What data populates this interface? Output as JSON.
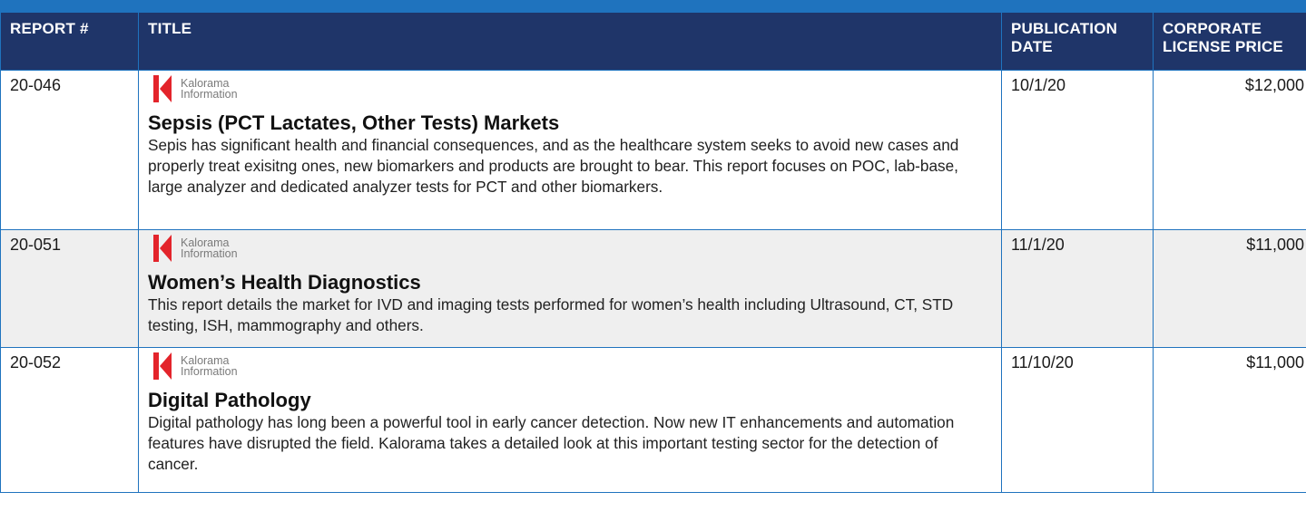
{
  "table": {
    "headers": {
      "report_num": "REPORT #",
      "title": "TITLE",
      "pub_date": "PUBLICATION DATE",
      "price": "CORPORATE LICENSE PRICE"
    },
    "rows": [
      {
        "report_num": "20-046",
        "publisher_line1": "Kalorama",
        "publisher_line2": "Information",
        "title": "Sepsis (PCT Lactates, Other Tests) Markets",
        "description": "Sepis has significant health and financial consequences, and as the healthcare system seeks to avoid new cases and properly treat exisitng ones, new biomarkers and products are brought to bear. This report focuses on POC, lab-base, large analyzer and dedicated analyzer tests for PCT and other biomarkers.",
        "pub_date": "10/1/20",
        "price": "$12,000"
      },
      {
        "report_num": "20-051",
        "publisher_line1": "Kalorama",
        "publisher_line2": "Information",
        "title": "Women’s Health Diagnostics",
        "description": "This report details the market for IVD and imaging tests performed for women’s health including Ultrasound, CT, STD testing, ISH, mammography and others.",
        "pub_date": "11/1/20",
        "price": "$11,000"
      },
      {
        "report_num": "20-052",
        "publisher_line1": "Kalorama",
        "publisher_line2": "Information",
        "title": "Digital Pathology",
        "description": "Digital pathology has long been a powerful tool in early cancer detection. Now new IT enhancements and automation features have disrupted the field. Kalorama takes a detailed look at this important testing sector for the detection of cancer.",
        "pub_date": "11/10/20",
        "price": "$11,000"
      }
    ]
  },
  "colors": {
    "header_bg": "#1f3569",
    "border": "#1f73be",
    "logo_red": "#e3242b",
    "shaded_row": "#efefef"
  },
  "icons": {
    "publisher_logo": "kalorama-k-logo"
  }
}
